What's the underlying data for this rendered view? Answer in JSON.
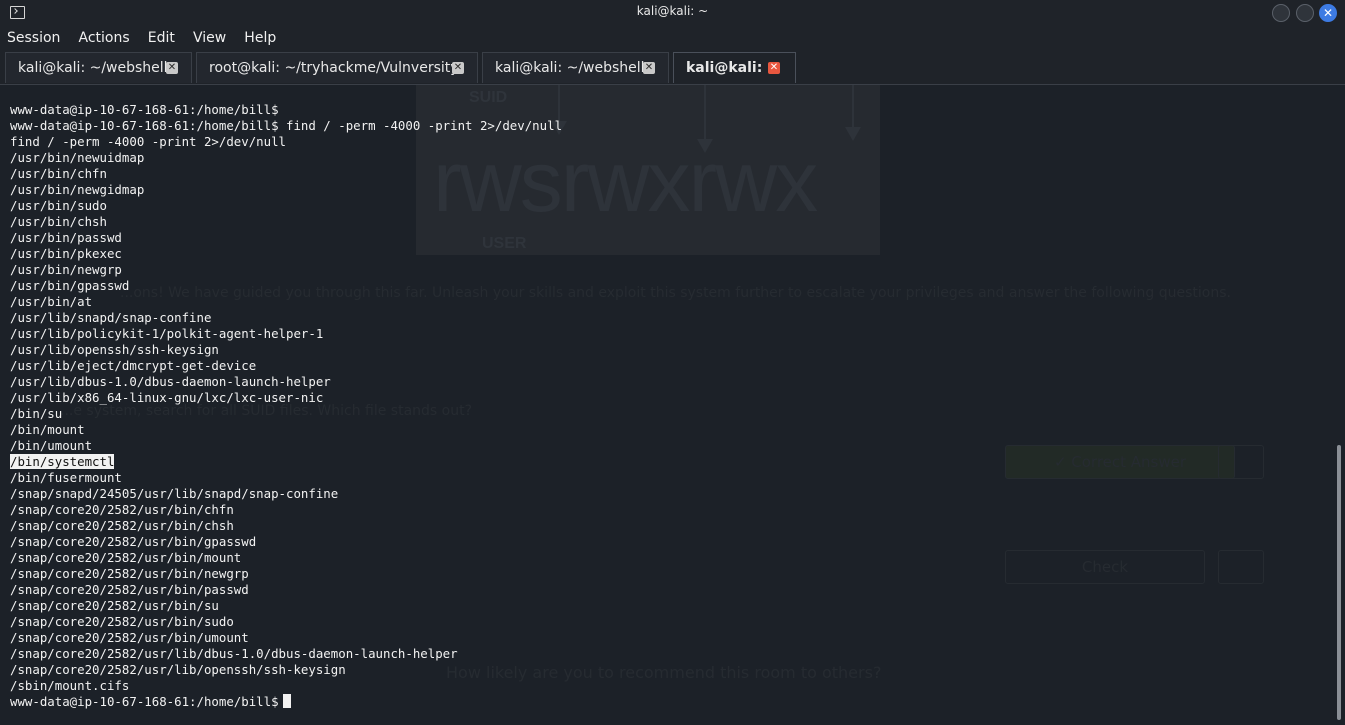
{
  "window": {
    "title": "kali@kali: ~"
  },
  "menu": [
    "Session",
    "Actions",
    "Edit",
    "View",
    "Help"
  ],
  "tabs": [
    {
      "label": "kali@kali: ~/webshell",
      "active": false
    },
    {
      "label": "root@kali: ~/tryhackme/Vulnversity",
      "active": false
    },
    {
      "label": "kali@kali: ~/webshell",
      "active": false
    },
    {
      "label": "kali@kali: ~",
      "active": true
    }
  ],
  "background_page": {
    "perm_string": "rwsrwxrwx",
    "suid_label": "SUID",
    "user_label": "USER",
    "intro_text": "...ons! We have guided you through this far. Unleash your skills and exploit this system further to escalate your privileges and answer the following questions.",
    "question_text": "...e system, search for all SUID files. Which file stands out?",
    "correct_answer_button": "✓ Correct Answer",
    "check_button": "Check",
    "recommend_text": "How likely are you to recommend this room to others?"
  },
  "terminal": {
    "lines": [
      "www-data@ip-10-67-168-61:/home/bill$",
      "www-data@ip-10-67-168-61:/home/bill$ find / -perm -4000 -print 2>/dev/null",
      "find / -perm -4000 -print 2>/dev/null",
      "/usr/bin/newuidmap",
      "/usr/bin/chfn",
      "/usr/bin/newgidmap",
      "/usr/bin/sudo",
      "/usr/bin/chsh",
      "/usr/bin/passwd",
      "/usr/bin/pkexec",
      "/usr/bin/newgrp",
      "/usr/bin/gpasswd",
      "/usr/bin/at",
      "/usr/lib/snapd/snap-confine",
      "/usr/lib/policykit-1/polkit-agent-helper-1",
      "/usr/lib/openssh/ssh-keysign",
      "/usr/lib/eject/dmcrypt-get-device",
      "/usr/lib/dbus-1.0/dbus-daemon-launch-helper",
      "/usr/lib/x86_64-linux-gnu/lxc/lxc-user-nic",
      "/bin/su",
      "/bin/mount",
      "/bin/umount",
      "/bin/systemctl",
      "/bin/fusermount",
      "/snap/snapd/24505/usr/lib/snapd/snap-confine",
      "/snap/core20/2582/usr/bin/chfn",
      "/snap/core20/2582/usr/bin/chsh",
      "/snap/core20/2582/usr/bin/gpasswd",
      "/snap/core20/2582/usr/bin/mount",
      "/snap/core20/2582/usr/bin/newgrp",
      "/snap/core20/2582/usr/bin/passwd",
      "/snap/core20/2582/usr/bin/su",
      "/snap/core20/2582/usr/bin/sudo",
      "/snap/core20/2582/usr/bin/umount",
      "/snap/core20/2582/usr/lib/dbus-1.0/dbus-daemon-launch-helper",
      "/snap/core20/2582/usr/lib/openssh/ssh-keysign",
      "/sbin/mount.cifs"
    ],
    "highlighted_line_index": 22,
    "prompt": "www-data@ip-10-67-168-61:/home/bill$"
  }
}
